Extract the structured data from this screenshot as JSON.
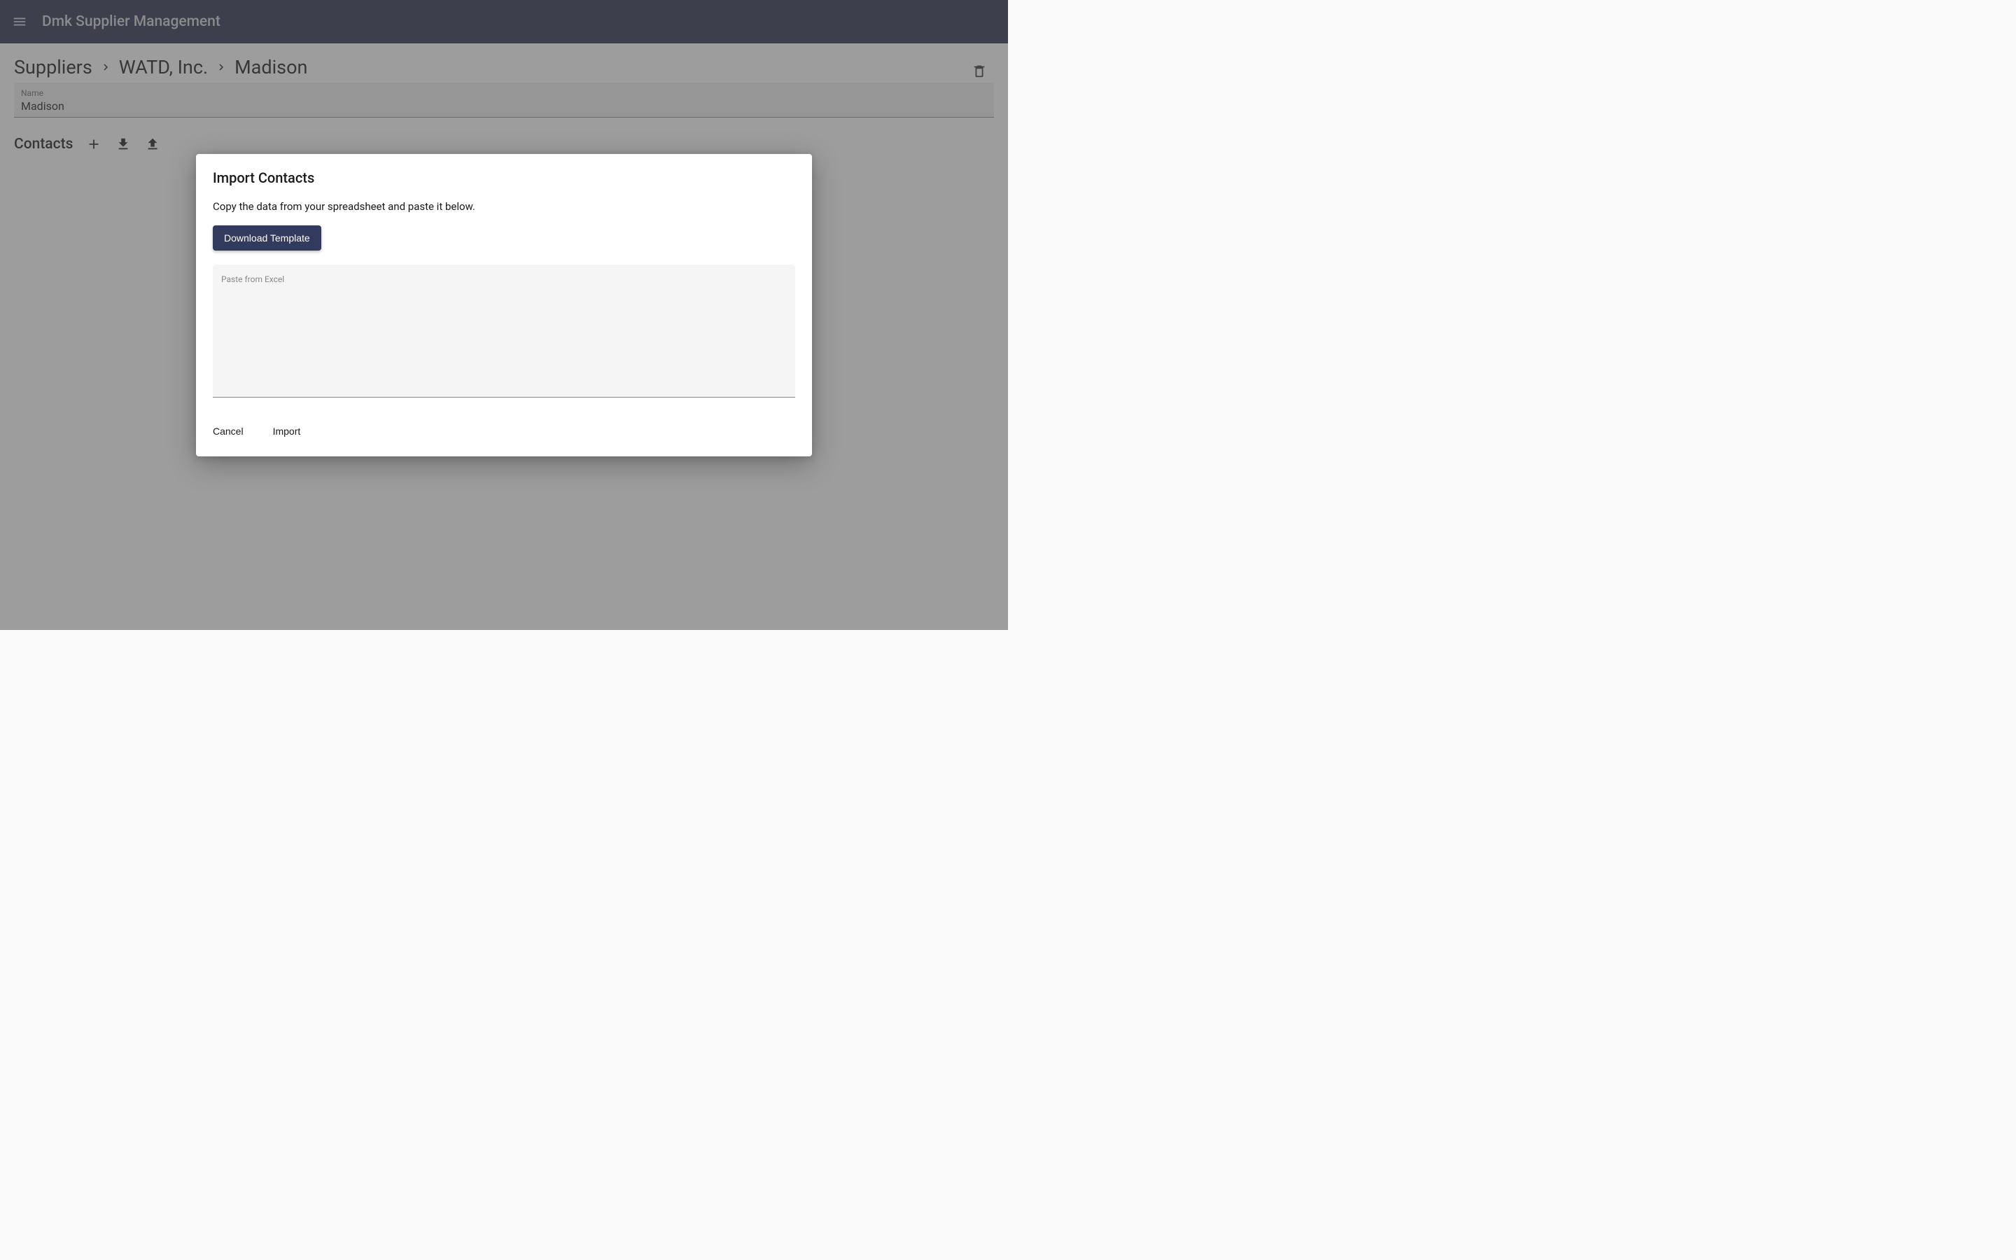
{
  "appbar": {
    "title": "Dmk Supplier Management"
  },
  "breadcrumb": {
    "items": [
      "Suppliers",
      "WATD, Inc.",
      "Madison"
    ]
  },
  "name_field": {
    "label": "Name",
    "value": "Madison"
  },
  "contacts": {
    "title": "Contacts"
  },
  "dialog": {
    "title": "Import Contacts",
    "instruction": "Copy the data from your spreadsheet and paste it below.",
    "download_label": "Download Template",
    "paste_label": "Paste from Excel",
    "cancel_label": "Cancel",
    "import_label": "Import"
  }
}
